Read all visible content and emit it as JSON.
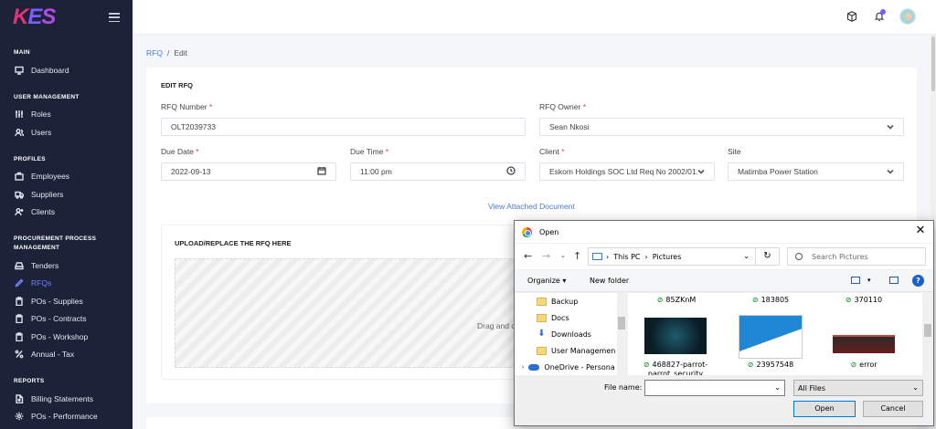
{
  "logo": "KES",
  "sidebar": {
    "sections": [
      {
        "title": "MAIN",
        "items": [
          {
            "label": "Dashboard",
            "icon": "monitor-icon"
          }
        ]
      },
      {
        "title": "USER MANAGEMENT",
        "items": [
          {
            "label": "Roles",
            "icon": "sliders-icon"
          },
          {
            "label": "Users",
            "icon": "users-icon"
          }
        ]
      },
      {
        "title": "PROFILES",
        "items": [
          {
            "label": "Employees",
            "icon": "briefcase-icon"
          },
          {
            "label": "Suppliers",
            "icon": "truck-icon"
          },
          {
            "label": "Clients",
            "icon": "user-plus-icon"
          }
        ]
      },
      {
        "title": "PROCUREMENT PROCESS MANAGEMENT",
        "items": [
          {
            "label": "Tenders",
            "icon": "hard-drive-icon"
          },
          {
            "label": "RFQs",
            "icon": "pen-icon",
            "active": true
          },
          {
            "label": "POs - Supplies",
            "icon": "clipboard-icon"
          },
          {
            "label": "POs - Contracts",
            "icon": "clipboard-icon"
          },
          {
            "label": "POs - Workshop",
            "icon": "clipboard-icon"
          },
          {
            "label": "Annual - Tax",
            "icon": "percent-icon"
          }
        ]
      },
      {
        "title": "REPORTS",
        "items": [
          {
            "label": "Billing Statements",
            "icon": "file-icon"
          },
          {
            "label": "POs - Performance",
            "icon": "gear-icon"
          }
        ]
      }
    ]
  },
  "breadcrumb": {
    "parent": "RFQ",
    "separator": "/",
    "current": "Edit"
  },
  "form": {
    "title": "EDIT RFQ",
    "rfq_number": {
      "label": "RFQ Number",
      "value": "OLT2039733"
    },
    "rfq_owner": {
      "label": "RFQ Owner",
      "value": "Sean Nkosi"
    },
    "due_date": {
      "label": "Due Date",
      "value": "2022-09-13"
    },
    "due_time": {
      "label": "Due Time",
      "value": "11:00 pm"
    },
    "client": {
      "label": "Client",
      "value": "Eskom Holdings SOC Ltd Req No 2002/01..."
    },
    "site": {
      "label": "Site",
      "value": "Matimba Power Station"
    },
    "required_marker": "*",
    "view_attached": "View Attached Document",
    "upload_title": "UPLOAD/REPLACE THE RFQ HERE",
    "drop_text": "Drag and d"
  },
  "dialog": {
    "title": "Open",
    "close": "✕",
    "path": [
      "This PC",
      "Pictures"
    ],
    "search_placeholder": "Search Pictures",
    "organize": "Organize ▾",
    "new_folder": "New folder",
    "tree": [
      {
        "label": "Backup",
        "type": "folder"
      },
      {
        "label": "Docs",
        "type": "folder"
      },
      {
        "label": "Downloads",
        "type": "download"
      },
      {
        "label": "User Managemen",
        "type": "folder"
      },
      {
        "label": "OneDrive - Persona",
        "type": "onedrive"
      }
    ],
    "files_top": [
      "85ZKnM",
      "183805",
      "370110"
    ],
    "files_bottom": [
      "468827-parrot-",
      "23957548",
      "error"
    ],
    "file_sub": "parrot_security",
    "file_name_label": "File name:",
    "file_name_value": "",
    "file_type": "All Files",
    "open_button": "Open",
    "cancel_button": "Cancel"
  },
  "colors": {
    "sidebar_bg": "#1c2237",
    "accent": "#6f86ff",
    "link": "#4a7bd8",
    "required": "#e03b3b"
  }
}
